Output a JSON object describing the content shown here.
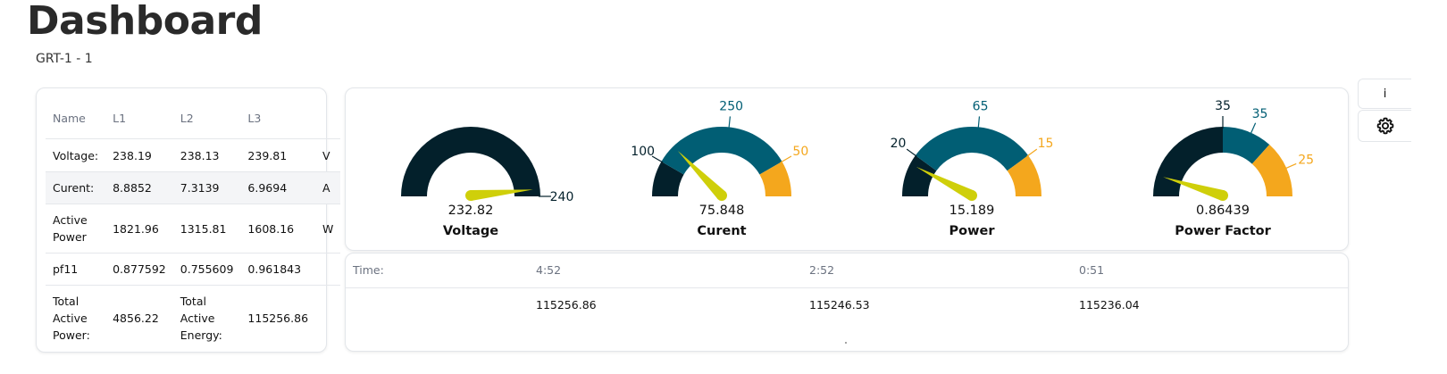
{
  "page": {
    "title": "Dashboard",
    "subtitle": "GRT-1 - 1"
  },
  "table": {
    "headers": [
      "Name",
      "L1",
      "L2",
      "L3",
      ""
    ],
    "rows": [
      [
        "Voltage:",
        "238.19",
        "238.13",
        "239.81",
        "V"
      ],
      [
        "Curent:",
        "8.8852",
        "7.3139",
        "6.9694",
        "A"
      ],
      [
        "Active Power",
        "1821.96",
        "1315.81",
        "1608.16",
        "W"
      ],
      [
        "pf11",
        "0.877592",
        "0.755609",
        "0.961843",
        ""
      ],
      [
        "Total Active Power:",
        "4856.22",
        "Total Active Energy:",
        "115256.86",
        ""
      ]
    ]
  },
  "gauges": [
    {
      "title": "Voltage",
      "value": "232.82",
      "min": 0,
      "max": 240,
      "bands": [
        [
          0,
          240,
          "#03202b"
        ]
      ],
      "ticks": [
        {
          "label": "240",
          "at": 240,
          "color": "#03202b"
        }
      ],
      "needle": 232.82
    },
    {
      "title": "Curent",
      "value": "75.848",
      "min": 0,
      "max": 300,
      "bands": [
        [
          0,
          50,
          "#03202b"
        ],
        [
          50,
          250,
          "#015e74"
        ],
        [
          250,
          300,
          "#f4a71d"
        ]
      ],
      "ticks": [
        {
          "label": "100",
          "at": 50,
          "color": "#03202b"
        },
        {
          "label": "250",
          "at": 160,
          "color": "#015e74"
        },
        {
          "label": "50",
          "at": 250,
          "color": "#f4a71d"
        }
      ],
      "needle": 75.848
    },
    {
      "title": "Power",
      "value": "15.189",
      "min": 0,
      "max": 100,
      "bands": [
        [
          0,
          20,
          "#03202b"
        ],
        [
          20,
          80,
          "#015e74"
        ],
        [
          80,
          100,
          "#f4a71d"
        ]
      ],
      "ticks": [
        {
          "label": "20",
          "at": 20,
          "color": "#03202b"
        },
        {
          "label": "65",
          "at": 53,
          "color": "#015e74"
        },
        {
          "label": "15",
          "at": 80,
          "color": "#f4a71d"
        }
      ],
      "needle": 15.189
    },
    {
      "title": "Power Factor",
      "value": "0.86439",
      "min": 0.85,
      "max": 1.0,
      "bands": [
        [
          0.85,
          0.925,
          "#03202b"
        ],
        [
          0.925,
          0.96,
          "#015e74"
        ],
        [
          0.96,
          1.0,
          "#f4a71d"
        ]
      ],
      "ticks": [
        {
          "label": "35",
          "at": 0.925,
          "color": "#03202b"
        },
        {
          "label": "35",
          "at": 0.945,
          "color": "#015e74"
        },
        {
          "label": "25",
          "at": 0.98,
          "color": "#f4a71d"
        }
      ],
      "needle": 0.86439
    }
  ],
  "history": {
    "label": "Time:",
    "times": [
      "4:52",
      "2:52",
      "0:51"
    ],
    "values": [
      "115256.86",
      "115246.53",
      "115236.04"
    ]
  },
  "side": {
    "info_label": "i",
    "settings_icon": "gear-icon"
  },
  "colors": {
    "dark": "#03202b",
    "teal": "#015e74",
    "orange": "#f4a71d",
    "needle": "#cfcf0a"
  }
}
